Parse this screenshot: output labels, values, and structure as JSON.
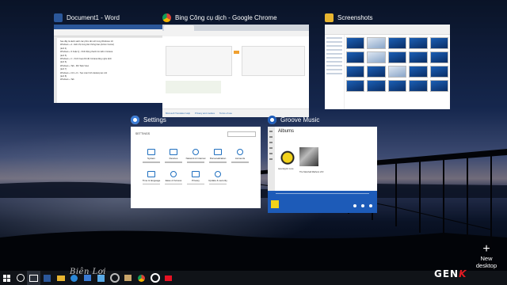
{
  "windows": {
    "word": {
      "title": "Document1 - Word",
      "icon": "word-icon",
      "icon_color": "#2b579a",
      "doc_lines": [
        "Sau đây là danh sách các phím tắt mới trong Windows 10:",
        "Windows + A - Hiển thị trung tâm thông báo (Action Center)",
        "(ảnh 4)",
        "Windows + S hoặc Q - Khởi động thanh tìm kiếm Cortana",
        "(ảnh 5)",
        "Windows + C - Kích hoạt chế độ Cortana lắng nghe lệnh",
        "(ảnh 6)",
        "Windows + Tab - Mở Task View",
        "(ảnh 7)",
        "Windows + Ctrl + D - Tạo màn hình desktop ảo mới",
        "(ảnh 8)",
        "Windows + Tab"
      ]
    },
    "chrome": {
      "title": "Bing Công cụ dịch - Google Chrome",
      "icon": "chrome-icon",
      "footer_links": [
        "Microsoft Translator Help",
        "Privacy and cookies",
        "Terms of use"
      ]
    },
    "explorer": {
      "title": "Screenshots",
      "icon": "folder-icon",
      "icon_color": "#e8b530"
    },
    "settings": {
      "title": "Settings",
      "icon": "gear-icon",
      "header": "SETTINGS",
      "items": [
        "System",
        "Devices",
        "Network & Internet",
        "Personalization",
        "Accounts",
        "Time & language",
        "Ease of Access",
        "Privacy",
        "Update & security"
      ]
    },
    "groove": {
      "title": "Groove Music",
      "icon": "groove-icon",
      "heading": "Albums",
      "album_1": "Apocalyptic Love",
      "album_2": "The Marshall Mathers LP2"
    }
  },
  "new_desktop_label": "New desktop",
  "watermark": {
    "brand_prefix": "GEN",
    "brand_suffix": "K"
  },
  "colors": {
    "taskbar": "#101318",
    "accent": "#1d5bb8",
    "genk_red": "#e31b23"
  }
}
